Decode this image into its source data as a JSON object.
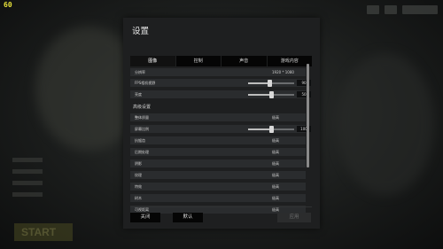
{
  "overlay": {
    "fps": "60",
    "start_label": "START"
  },
  "dialog": {
    "title": "设置",
    "tabs": [
      {
        "label": "图像",
        "active": true
      },
      {
        "label": "控制",
        "active": false
      },
      {
        "label": "声音",
        "active": false
      },
      {
        "label": "游戏内容",
        "active": false
      }
    ],
    "rows_top": [
      {
        "label": "分辨率",
        "value": "1920 * 1080"
      },
      {
        "label": "FPS相机视野",
        "value": "90",
        "slider_fraction": 0.47
      },
      {
        "label": "亮度",
        "value": "50",
        "slider_fraction": 0.5
      }
    ],
    "advanced_section_label": "高级设置",
    "rows_advanced": [
      {
        "label": "整体质量",
        "value": "极高"
      },
      {
        "label": "屏幕比例",
        "value": "100",
        "slider_fraction": 0.5
      },
      {
        "label": "抗锯齿",
        "value": "极高"
      },
      {
        "label": "后期处理",
        "value": "极高"
      },
      {
        "label": "阴影",
        "value": "极高"
      },
      {
        "label": "纹理",
        "value": "极高"
      },
      {
        "label": "特效",
        "value": "极高"
      },
      {
        "label": "树木",
        "value": "极高"
      },
      {
        "label": "可视距离",
        "value": "极高"
      }
    ],
    "buttons": {
      "close": "关闭",
      "default": "默认",
      "apply": "应用"
    }
  },
  "colors": {
    "fps": "#e8e23a",
    "panel": "#1e1f20",
    "row": "#2a2c2e",
    "tab": "#050505"
  }
}
